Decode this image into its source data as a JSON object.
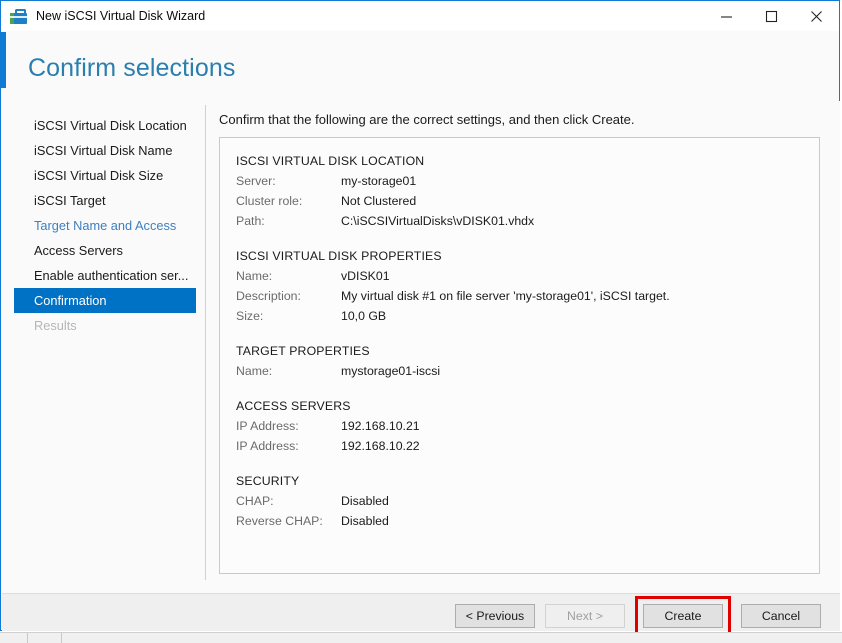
{
  "window": {
    "title": "New iSCSI Virtual Disk Wizard",
    "icon": "toolbox-icon",
    "controls": {
      "minimize": "minimize-icon",
      "maximize": "maximize-icon",
      "close": "close-icon"
    },
    "accent_color": "#0f7bd4"
  },
  "header": {
    "heading": "Confirm selections",
    "heading_color": "#2a7fae"
  },
  "sidebar": {
    "items": [
      {
        "label": "iSCSI Virtual Disk Location",
        "state": "normal"
      },
      {
        "label": "iSCSI Virtual Disk Name",
        "state": "normal"
      },
      {
        "label": "iSCSI Virtual Disk Size",
        "state": "normal"
      },
      {
        "label": "iSCSI Target",
        "state": "normal"
      },
      {
        "label": "Target Name and Access",
        "state": "visited"
      },
      {
        "label": "Access Servers",
        "state": "normal"
      },
      {
        "label": "Enable authentication ser...",
        "state": "normal"
      },
      {
        "label": "Confirmation",
        "state": "current"
      },
      {
        "label": "Results",
        "state": "disabled"
      }
    ],
    "current_color": "#0072c6",
    "visited_color": "#3f7fbf"
  },
  "content": {
    "intro": "Confirm that the following are the correct settings, and then click Create.",
    "sections": [
      {
        "title": "ISCSI VIRTUAL DISK LOCATION",
        "rows": [
          {
            "key": "Server:",
            "value": "my-storage01"
          },
          {
            "key": "Cluster role:",
            "value": "Not Clustered"
          },
          {
            "key": "Path:",
            "value": "C:\\iSCSIVirtualDisks\\vDISK01.vhdx"
          }
        ]
      },
      {
        "title": "ISCSI VIRTUAL DISK PROPERTIES",
        "rows": [
          {
            "key": "Name:",
            "value": "vDISK01"
          },
          {
            "key": "Description:",
            "value": "My virtual disk #1 on file server 'my-storage01', iSCSI target."
          },
          {
            "key": "Size:",
            "value": "10,0 GB"
          }
        ]
      },
      {
        "title": "TARGET PROPERTIES",
        "rows": [
          {
            "key": "Name:",
            "value": "mystorage01-iscsi"
          }
        ]
      },
      {
        "title": "ACCESS SERVERS",
        "rows": [
          {
            "key": "IP Address:",
            "value": "192.168.10.21"
          },
          {
            "key": "IP Address:",
            "value": "192.168.10.22"
          }
        ]
      },
      {
        "title": "SECURITY",
        "rows": [
          {
            "key": "CHAP:",
            "value": "Disabled"
          },
          {
            "key": "Reverse CHAP:",
            "value": "Disabled"
          }
        ]
      }
    ]
  },
  "footer": {
    "previous_label": "< Previous",
    "next_label": "Next >",
    "create_label": "Create",
    "cancel_label": "Cancel",
    "next_disabled": true,
    "highlight_color": "#e00000",
    "highlighted_button": "Create"
  }
}
